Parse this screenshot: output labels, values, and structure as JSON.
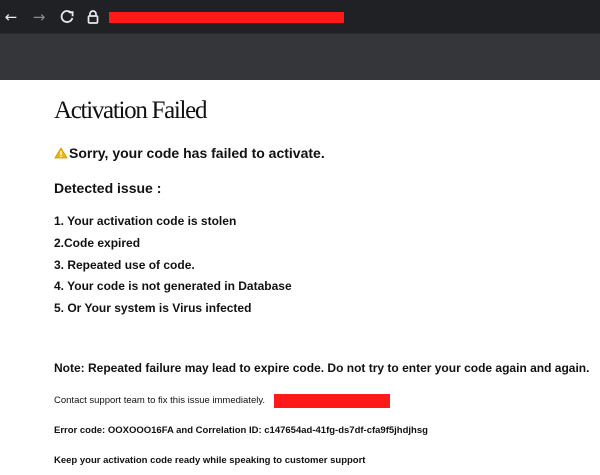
{
  "browser": {
    "back_icon": "arrow-left-icon",
    "forward_icon": "arrow-right-icon",
    "reload_icon": "reload-icon",
    "lock_icon": "lock-icon",
    "url_redaction_color": "#ff1a1a"
  },
  "page": {
    "title": "Activation Failed",
    "sorry_text": "Sorry, your code has failed to activate.",
    "warning_icon": "warning-icon",
    "detected_heading": "Detected issue :",
    "issues": [
      "1. Your activation code is stolen",
      "2.Code expired",
      "3. Repeated use of code.",
      "4. Your code is not generated in Database",
      "5. Or Your system is Virus infected"
    ],
    "note": "Note: Repeated failure may lead to expire code. Do not try to enter your code again and again.",
    "contact_text": "Contact support team to fix this issue immediately.",
    "error_text": "Error code: OOXOOO16FA and Correlation ID: c147654ad-41fg-ds7df-cfa9f5jhdjhsg",
    "keep_text": "Keep your activation code ready while speaking to customer support"
  },
  "colors": {
    "browser_bar": "#202124",
    "toolbar_strip": "#35363a",
    "redaction": "#ff1a1a",
    "warning": "#f5b800"
  }
}
